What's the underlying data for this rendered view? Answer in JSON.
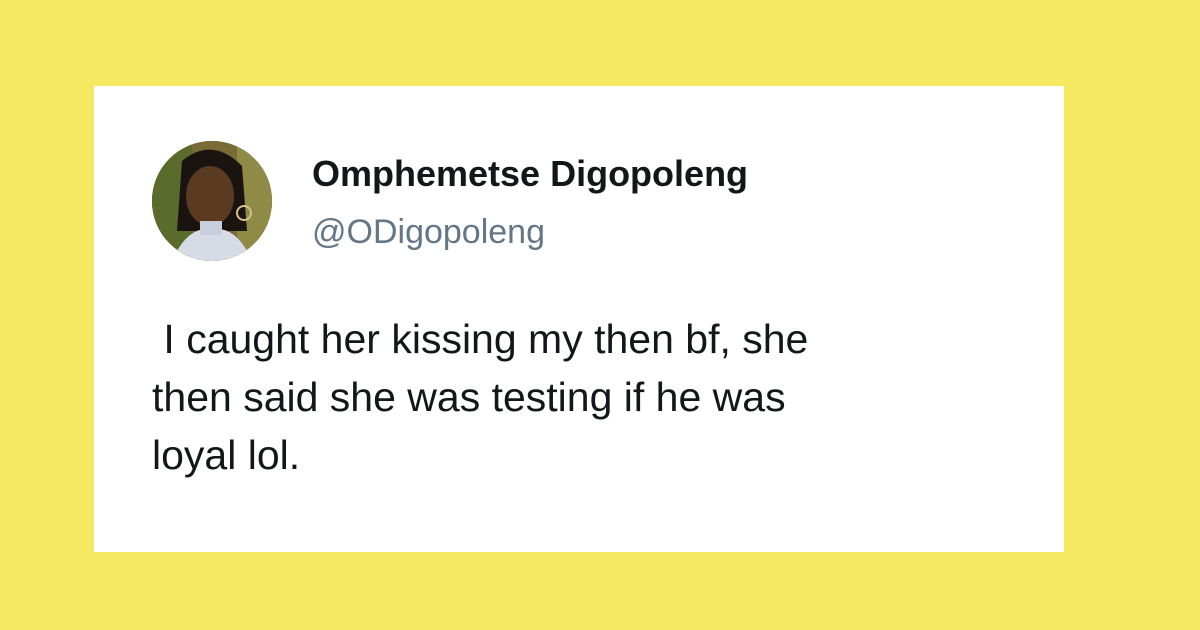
{
  "colors": {
    "background": "#f5e961",
    "card": "#ffffff",
    "name": "#14171a",
    "handle": "#657786",
    "text": "#14171a"
  },
  "tweet": {
    "avatar_icon": "profile-photo",
    "display_name": "Omphemetse Digopoleng",
    "handle": "@ODigopoleng",
    "text": " I caught her kissing my then bf, she\nthen said she was testing if he was\nloyal lol."
  }
}
